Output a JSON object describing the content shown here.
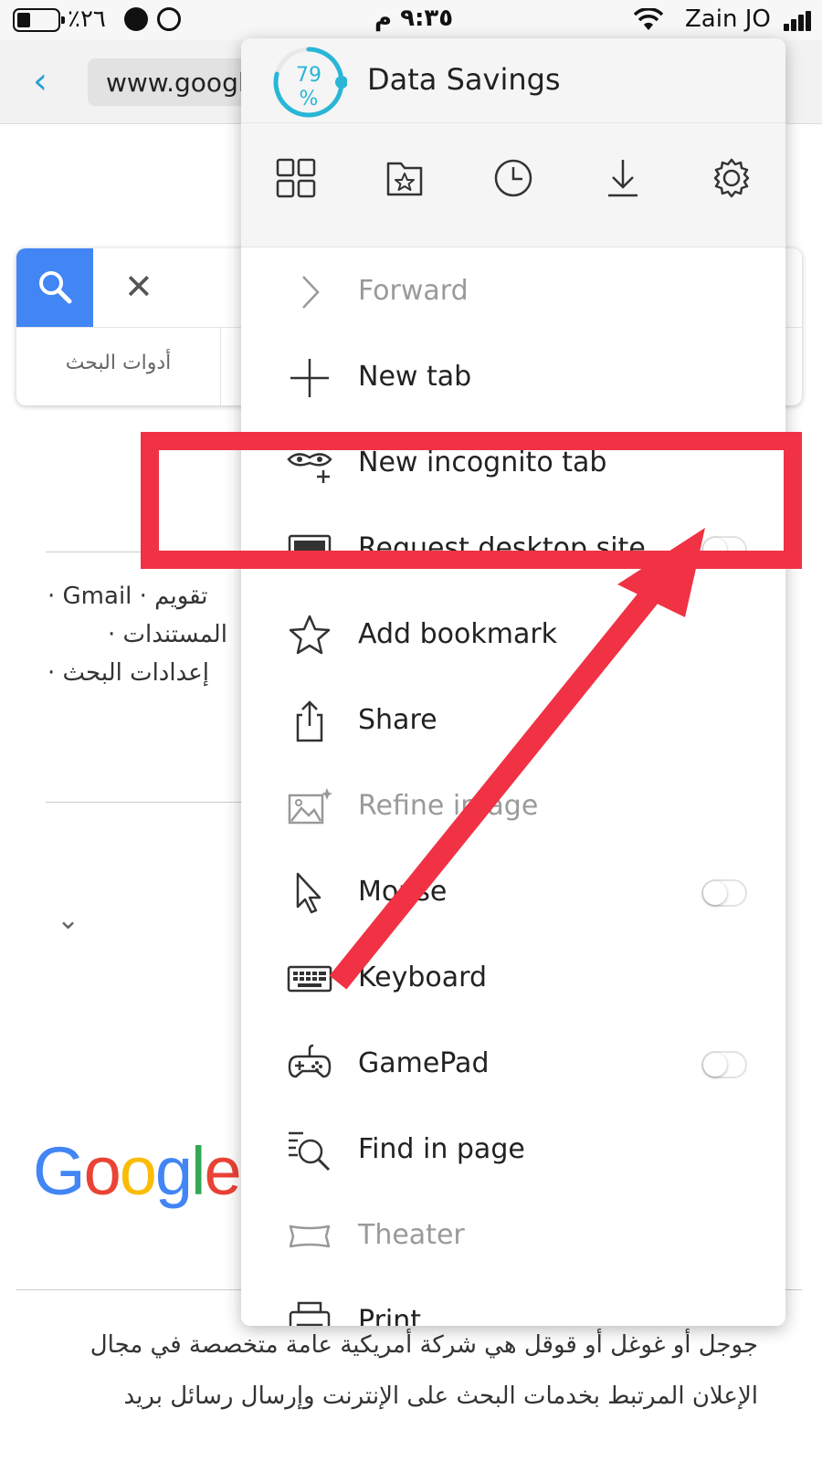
{
  "status_bar": {
    "battery_text": "٪٢٦",
    "time": "٩:٣٥ م",
    "carrier": "Zain JO"
  },
  "address_bar": {
    "url": "www.google.com"
  },
  "page": {
    "search_tools_label": "أدوات البحث",
    "links_line1": "تقويم · Gmail ·",
    "links_line2": "المستندات ·",
    "links_line3": "إعدادات البحث ·",
    "logo_text": "Google",
    "description_line1": "جوجل أو غوغل أو قوقل هي شركة أمريكية عامة متخصصة في مجال",
    "description_line2": "الإعلان المرتبط بخدمات البحث على الإنترنت وإرسال رسائل بريد"
  },
  "menu": {
    "data_savings_title": "Data Savings",
    "savings_value": "79",
    "savings_unit": "%",
    "quick_icons": [
      "grid-icon",
      "bookmarks-folder-icon",
      "history-clock-icon",
      "download-icon",
      "settings-gear-icon"
    ],
    "items": [
      {
        "label": "Forward",
        "icon": "forward-icon",
        "enabled": false
      },
      {
        "label": "New tab",
        "icon": "plus-icon",
        "enabled": true
      },
      {
        "label": "New incognito tab",
        "icon": "incognito-icon",
        "enabled": true
      },
      {
        "label": "Request desktop site",
        "icon": "desktop-icon",
        "enabled": true,
        "toggle": false
      },
      {
        "label": "Add bookmark",
        "icon": "star-icon",
        "enabled": true
      },
      {
        "label": "Share",
        "icon": "share-icon",
        "enabled": true
      },
      {
        "label": "Refine image",
        "icon": "refine-image-icon",
        "enabled": false
      },
      {
        "label": "Mouse",
        "icon": "mouse-pointer-icon",
        "enabled": true,
        "toggle": false
      },
      {
        "label": "Keyboard",
        "icon": "keyboard-icon",
        "enabled": true
      },
      {
        "label": "GamePad",
        "icon": "gamepad-icon",
        "enabled": true,
        "toggle": false
      },
      {
        "label": "Find in page",
        "icon": "find-in-page-icon",
        "enabled": true
      },
      {
        "label": "Theater",
        "icon": "theater-icon",
        "enabled": false
      },
      {
        "label": "Print",
        "icon": "printer-icon",
        "enabled": true
      }
    ]
  },
  "colors": {
    "accent": "#29b6d6",
    "highlight_red": "#f03244",
    "google_blue": "#4285f4"
  }
}
